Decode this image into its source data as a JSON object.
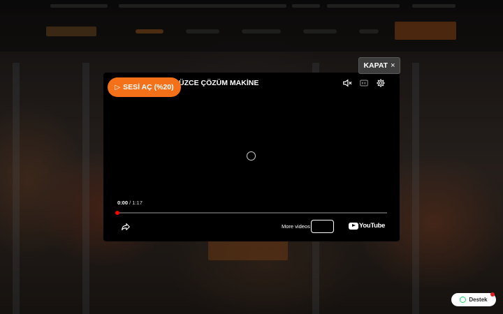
{
  "popup": {
    "close_label": "KAPAT",
    "close_icon": "×",
    "unmute_label": "SESİ AÇ (%20)",
    "video_title": "ÜZCE ÇÖZÜM MAKİNE",
    "current_time": "0:00",
    "duration": "/ 1:17",
    "more_videos_label": "More videos",
    "youtube_wordmark": "YouTube",
    "progress_fraction": 0
  },
  "support": {
    "label": "Destek"
  },
  "colors": {
    "accent": "#f4711a",
    "progress": "#ff0000",
    "whatsapp": "#25d366"
  }
}
